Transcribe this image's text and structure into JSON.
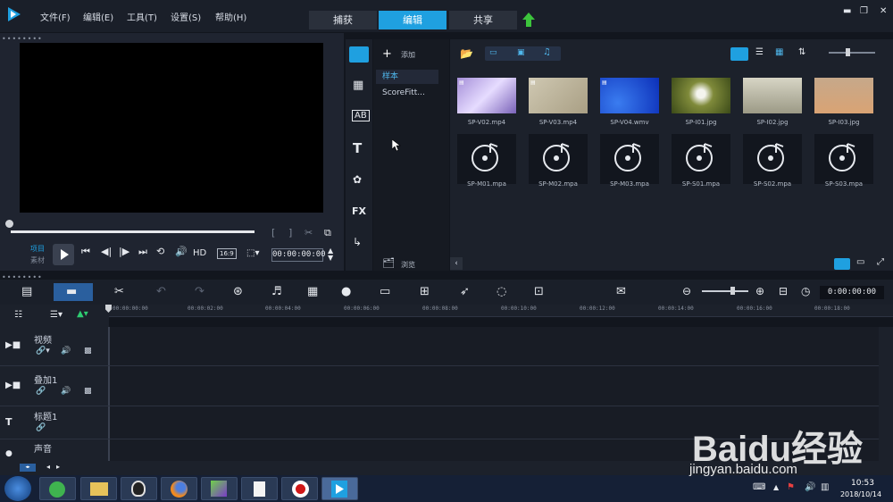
{
  "menu": {
    "file": "文件(F)",
    "edit": "编辑(E)",
    "tools": "工具(T)",
    "settings": "设置(S)",
    "help": "帮助(H)"
  },
  "tabs": {
    "capture": "捕获",
    "edit": "编辑",
    "share": "共享"
  },
  "player": {
    "project_label": "项目",
    "clip_label": "素材",
    "hd": "HD",
    "aspect": "16:9",
    "timecode": "00:00:00:00"
  },
  "library": {
    "add_label": "添加",
    "browse_label": "浏览",
    "folders": [
      "样本",
      "ScoreFitt..."
    ],
    "media": [
      {
        "name": "SP-V02.mp4",
        "kind": "video"
      },
      {
        "name": "SP-V03.mp4",
        "kind": "video"
      },
      {
        "name": "SP-V04.wmv",
        "kind": "video"
      },
      {
        "name": "SP-I01.jpg",
        "kind": "image"
      },
      {
        "name": "SP-I02.jpg",
        "kind": "image"
      },
      {
        "name": "SP-I03.jpg",
        "kind": "image"
      },
      {
        "name": "SP-M01.mpa",
        "kind": "audio"
      },
      {
        "name": "SP-M02.mpa",
        "kind": "audio"
      },
      {
        "name": "SP-M03.mpa",
        "kind": "audio"
      },
      {
        "name": "SP-S01.mpa",
        "kind": "audio"
      },
      {
        "name": "SP-S02.mpa",
        "kind": "audio"
      },
      {
        "name": "SP-S03.mpa",
        "kind": "audio"
      }
    ]
  },
  "timeline": {
    "timecode": "0:00:00:00",
    "ruler": [
      "00:00:00:00",
      "00:00:02:00",
      "00:00:04:00",
      "00:00:06:00",
      "00:00:08:00",
      "00:00:10:00",
      "00:00:12:00",
      "00:00:14:00",
      "00:00:16:00",
      "00:00:18:00"
    ],
    "tracks": [
      "视频",
      "叠加1",
      "标题1",
      "声音"
    ]
  },
  "taskbar": {
    "time": "10:53",
    "date": "2018/10/14"
  },
  "watermark": {
    "text": "Baidu经验",
    "url": "jingyan.baidu.com"
  },
  "colors": {
    "accent": "#1fa0e0",
    "share_arrow": "#3cc43c",
    "timeline_marker": "#2ecc71"
  }
}
